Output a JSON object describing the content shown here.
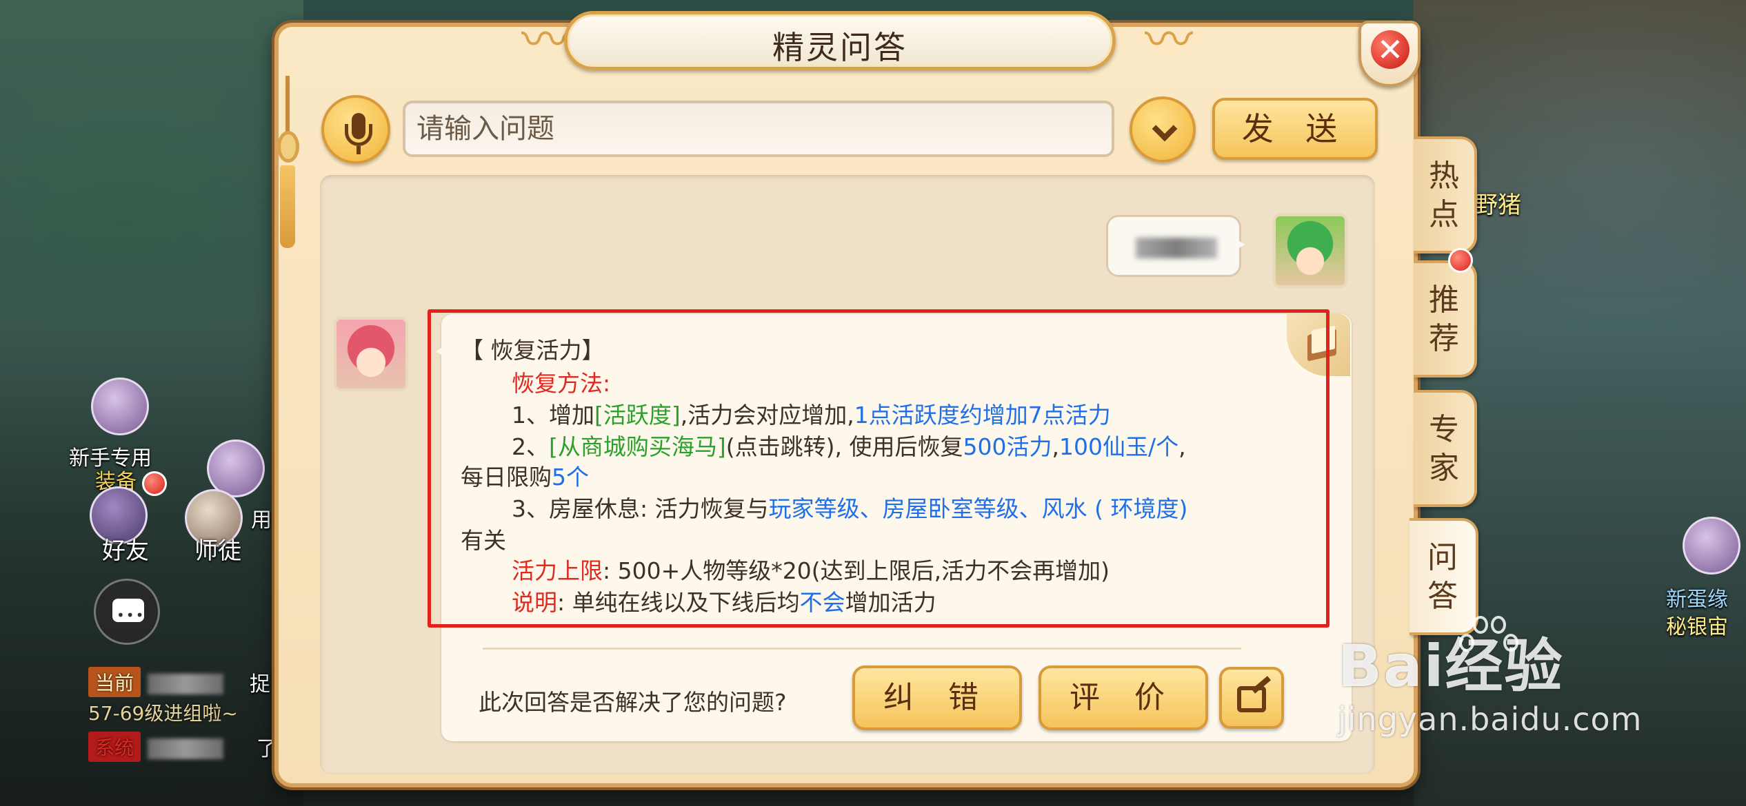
{
  "dialog": {
    "title": "精灵问答"
  },
  "input_bar": {
    "placeholder": "请输入问题",
    "send_label": "发 送"
  },
  "user_message": {
    "text_blurred": true
  },
  "answer": {
    "heading": "【 恢复活力】",
    "method_label": "恢复方法:",
    "item1_prefix": "1、增加",
    "item1_link": "[活跃度]",
    "item1_mid": ",活力会对应增加,",
    "item1_highlight": "1点活跃度约增加7点活力",
    "item2_prefix": "2、",
    "item2_link": "[从商城购买海马]",
    "item2_mid": "(点击跳转), 使用后恢复",
    "item2_hl1": "500活力",
    "item2_sep": ",",
    "item2_hl2": "100仙玉/个",
    "item2_end": ",",
    "item2_line2_prefix": "每日限购",
    "item2_line2_hl": "5个",
    "item3_prefix": "3、房屋休息: 活力恢复与",
    "item3_hl": "玩家等级、房屋卧室等级、风水 ( 环境度)",
    "item3_line2": "有关",
    "limit_label": "活力上限",
    "limit_text": ": 500+人物等级*20(达到上限后,活力不会再增加)",
    "note_label": "说明",
    "note_prefix": ": 单纯在线以及下线后均",
    "note_hl": "不会",
    "note_end": "增加活力"
  },
  "feedback": {
    "question": "此次回答是否解决了您的问题?",
    "correct_label": "纠 错",
    "rate_label": "评 价"
  },
  "side_tabs": [
    {
      "line1": "热",
      "line2": "点"
    },
    {
      "line1": "推",
      "line2": "荐"
    },
    {
      "line1": "专",
      "line2": "家"
    },
    {
      "line1": "问",
      "line2": "答"
    }
  ],
  "hud": {
    "newbie_label": "新手专用",
    "newbie_sub": "装备",
    "friends": "好友",
    "master": "师徒",
    "chat_current_tag": "当前",
    "chat_line1": "57-69级进组啦~",
    "chat_system_tag": "系统",
    "chat_sys_tail": "了玩",
    "chat_catch": "捉鬼",
    "right_npc1": "野猪",
    "right_npc2": "新蛋缘",
    "right_npc3": "秘银宙",
    "right_user": "用"
  },
  "watermark": {
    "logo": "Bai经验",
    "url": "jingyan.baidu.com"
  },
  "colors": {
    "highlight_red": "#e02a20",
    "link_blue": "#1f6fe8",
    "link_green": "#2aa12a",
    "button_gold": "#f5c45a",
    "frame_border": "#d7a35d"
  },
  "icons": [
    "microphone-icon",
    "chevron-down-icon",
    "close-icon",
    "book-icon",
    "share-icon",
    "chat-bubble-icon",
    "baidu-paw-icon"
  ]
}
